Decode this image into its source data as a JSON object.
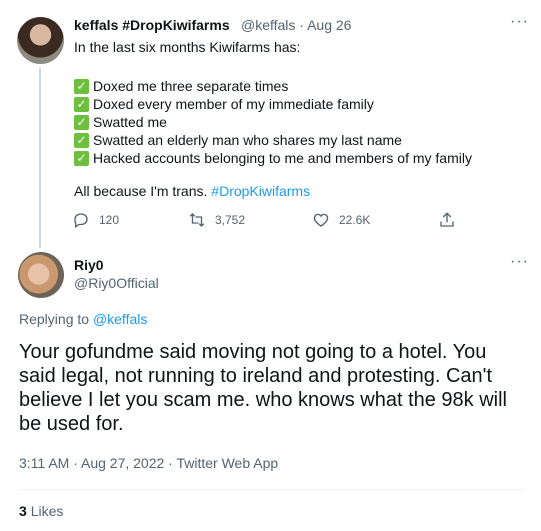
{
  "tweet": {
    "author_name": "keffals #DropKiwifarms",
    "author_handle": "@keffals",
    "date": "Aug 26",
    "intro": "In the last six months Kiwifarms has:",
    "items": [
      "Doxed me three separate times",
      "Doxed every member of my immediate family",
      "Swatted me",
      "Swatted an elderly man who shares my last name",
      "Hacked accounts belonging to me and members of my family"
    ],
    "closing_text": "All because I'm trans.",
    "closing_hashtag": "#DropKiwifarms",
    "reply_count": "120",
    "retweet_count": "3,752",
    "like_count": "22.6K",
    "check_color": "#6fbf3f"
  },
  "reply": {
    "author_name": "Riy0",
    "author_handle": "@Riy0Official",
    "replying_to_label": "Replying to",
    "replying_to_handle": "@keffals",
    "text": "Your gofundme said moving not going to a hotel. You said legal, not running to ireland and protesting. Can't believe I let you scam me.  who knows what the 98k will be used for.",
    "timestamp": "3:11 AM · Aug 27, 2022 · Twitter Web App",
    "likes_count": "3",
    "likes_label": "Likes"
  },
  "more_icon": "···",
  "accent_color": "#1d9bf0"
}
